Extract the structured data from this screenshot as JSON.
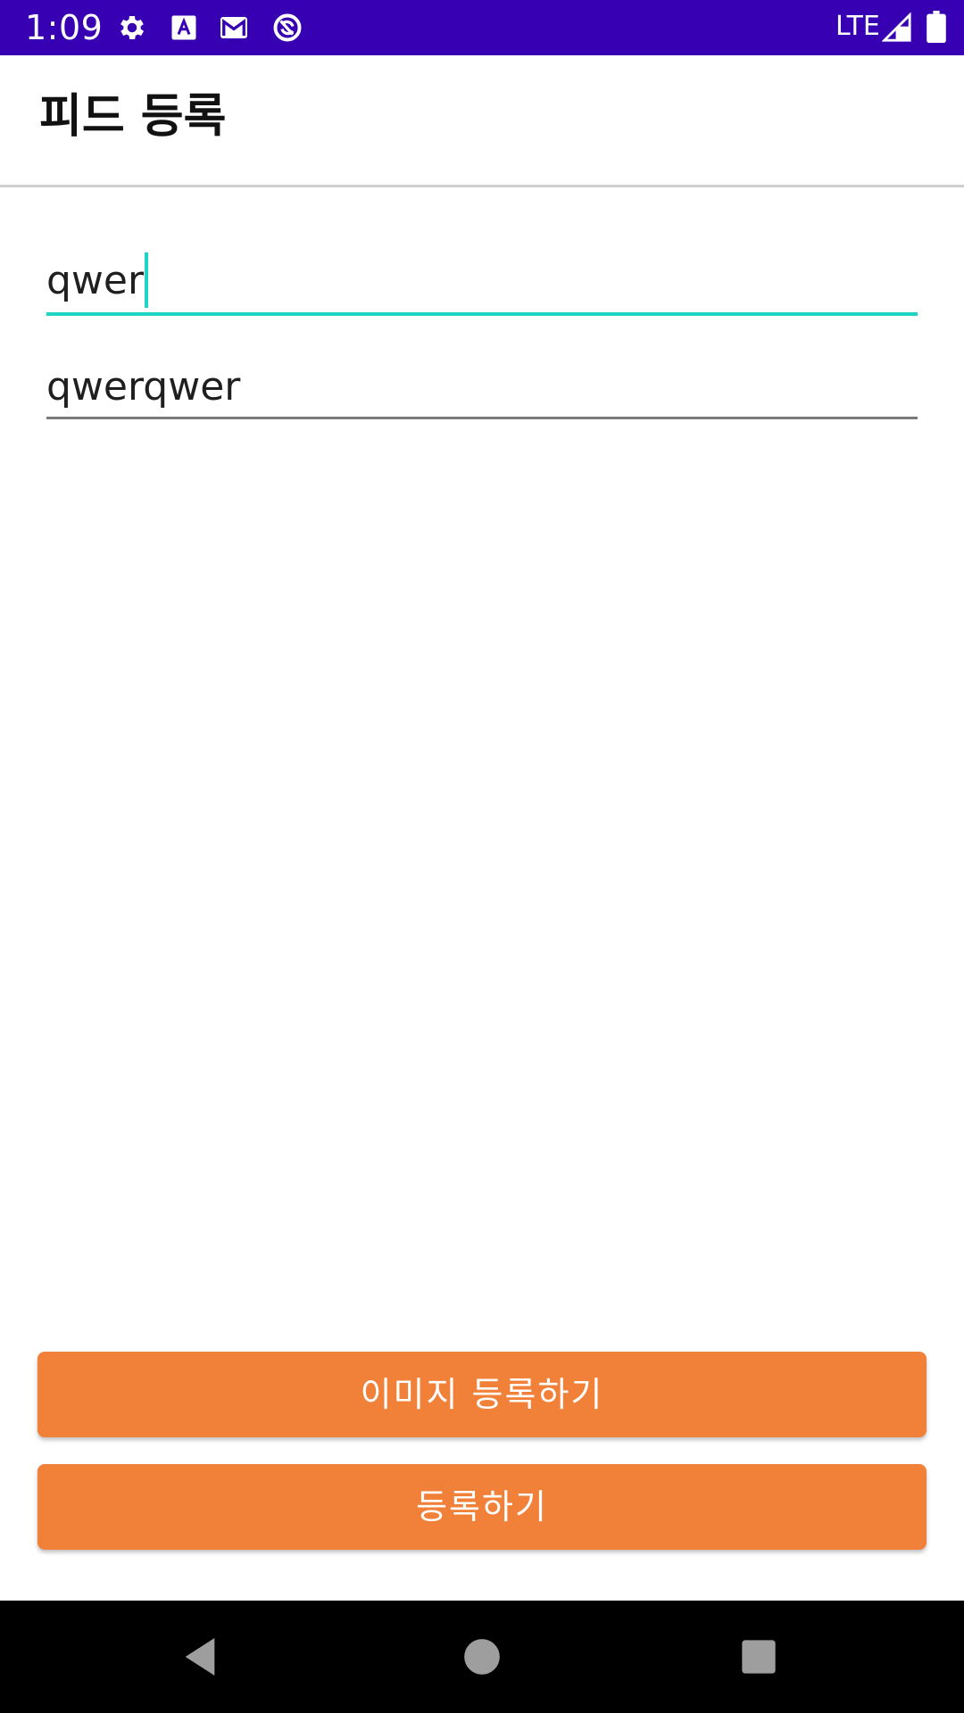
{
  "status_bar": {
    "time": "1:09",
    "network": "LTE",
    "icons": [
      "gear-icon",
      "font-icon",
      "gmail-icon",
      "sync-icon",
      "signal-icon",
      "battery-icon"
    ]
  },
  "app_bar": {
    "title": "피드 등록"
  },
  "form": {
    "title_field": {
      "value": "qwer",
      "focused": true
    },
    "content_field": {
      "value": "qwerqwer",
      "focused": false
    }
  },
  "buttons": {
    "image_register_label": "이미지 등록하기",
    "register_label": "등록하기"
  },
  "colors": {
    "status_bar": "#3700b3",
    "accent": "#1ed4c2",
    "button": "#f18139",
    "nav_bar": "#000000"
  },
  "nav_bar": {
    "icons": [
      "back-icon",
      "home-icon",
      "recents-icon"
    ]
  }
}
